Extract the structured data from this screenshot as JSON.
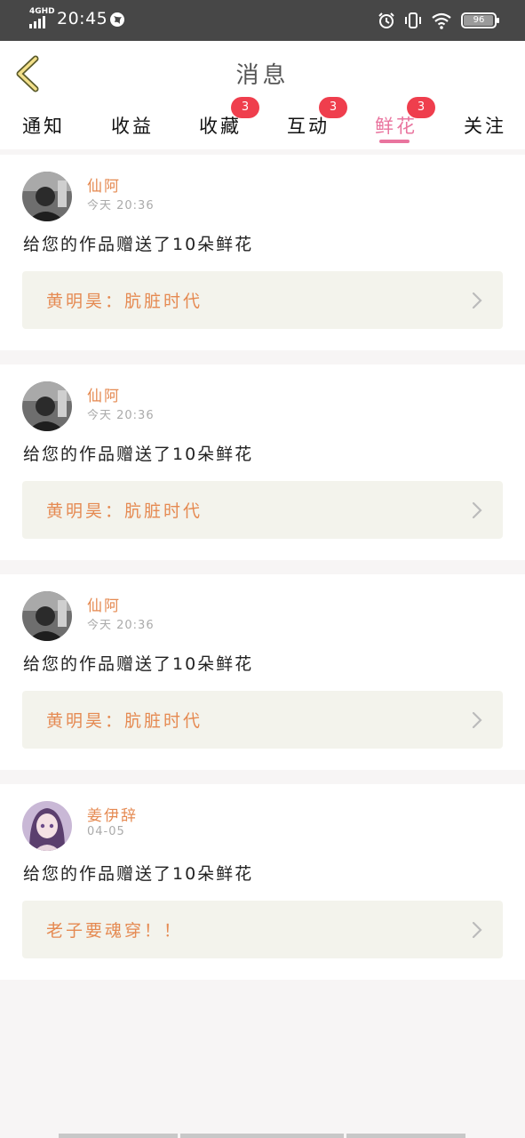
{
  "status_bar": {
    "network": "4GHD",
    "time": "20:45",
    "battery": "96",
    "battery_level": 0.96
  },
  "header": {
    "title": "消息"
  },
  "tabs": [
    {
      "label": "通知",
      "badge": ""
    },
    {
      "label": "收益",
      "badge": ""
    },
    {
      "label": "收藏",
      "badge": "3"
    },
    {
      "label": "互动",
      "badge": "3"
    },
    {
      "label": "鲜花",
      "badge": "3",
      "active": true
    },
    {
      "label": "关注",
      "badge": ""
    }
  ],
  "messages": [
    {
      "user": "仙阿",
      "time": "今天 20:36",
      "text": "给您的作品赠送了10朵鲜花",
      "work": "黄明昊：肮脏时代"
    },
    {
      "user": "仙阿",
      "time": "今天 20:36",
      "text": "给您的作品赠送了10朵鲜花",
      "work": "黄明昊：肮脏时代"
    },
    {
      "user": "仙阿",
      "time": "今天 20:36",
      "text": "给您的作品赠送了10朵鲜花",
      "work": "黄明昊：肮脏时代"
    },
    {
      "user": "姜伊辞",
      "time": "04-05",
      "text": "给您的作品赠送了10朵鲜花",
      "work": "老子要魂穿！！"
    }
  ],
  "colors": {
    "accent": "#e9749e",
    "username": "#e58a52",
    "badge": "#ef3e4d",
    "card_link_bg": "#f3f3ec"
  }
}
